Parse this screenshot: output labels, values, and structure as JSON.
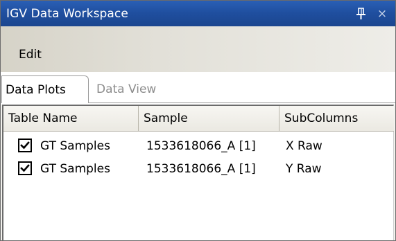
{
  "window": {
    "title": "IGV Data Workspace",
    "pin_icon": "pin-icon",
    "close_icon": "close-icon",
    "close_glyph": "×",
    "title_bar_color": "#1f4e9e"
  },
  "menu": {
    "items": [
      {
        "label": "Edit"
      }
    ]
  },
  "tabs": [
    {
      "label": "Data Plots",
      "active": true
    },
    {
      "label": "Data View",
      "active": false
    }
  ],
  "table": {
    "columns": [
      {
        "label": "Table Name"
      },
      {
        "label": "Sample"
      },
      {
        "label": "SubColumns"
      }
    ],
    "rows": [
      {
        "checked": true,
        "table_name": "GT Samples",
        "sample": "1533618066_A [1]",
        "subcolumn": "X Raw"
      },
      {
        "checked": true,
        "table_name": "GT Samples",
        "sample": "1533618066_A [1]",
        "subcolumn": "Y Raw"
      }
    ]
  }
}
